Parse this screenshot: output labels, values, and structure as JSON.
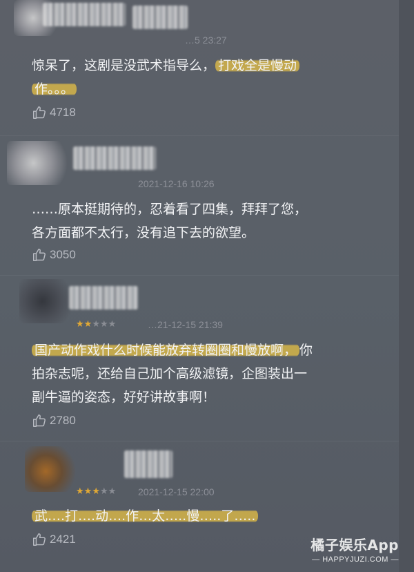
{
  "comments": [
    {
      "timestamp": "…5 23:27",
      "body_lines": [
        {
          "plain": "惊呆了，这剧是没武术指导么，",
          "highlight": "打戏全是慢动"
        },
        {
          "plain": "",
          "highlight": "作。。。"
        }
      ],
      "likes": "4718",
      "stars": {
        "filled": 0,
        "total": 0
      }
    },
    {
      "timestamp": "2021-12-16 10:26",
      "body_lines": [
        {
          "plain": "……原本挺期待的，忍着看了四集，拜拜了您，",
          "highlight": ""
        },
        {
          "plain": "各方面都不太行，没有追下去的欲望。",
          "highlight": ""
        }
      ],
      "likes": "3050",
      "stars": {
        "filled": 0,
        "total": 0
      }
    },
    {
      "timestamp": "…21-12-15 21:39",
      "body_lines": [
        {
          "plain": "",
          "highlight": "国产动作戏什么时候能放弃转圈圈和慢放啊，",
          "tail": "你"
        },
        {
          "plain": "拍杂志呢，还给自己加个高级滤镜，企图装出一",
          "highlight": ""
        },
        {
          "plain": "副牛逼的姿态，好好讲故事啊！",
          "highlight": ""
        }
      ],
      "likes": "2780",
      "stars": {
        "filled": 2,
        "total": 5
      }
    },
    {
      "timestamp": "2021-12-15 22:00",
      "body_lines": [
        {
          "plain": "",
          "highlight": "武….打….动….作…太…..慢…..了….."
        }
      ],
      "likes": "2421",
      "stars": {
        "filled": 3,
        "total": 5
      }
    }
  ],
  "watermark": {
    "brand": "橘子娱乐App",
    "url": "— HAPPYJUZI.COM —"
  },
  "icons": {
    "like": "thumbs-up-icon",
    "star": "star-icon"
  },
  "colors": {
    "background": "#5a5e66",
    "text": "#f1f2f4",
    "muted": "#b9bcc3",
    "highlight": "#e0bc46",
    "star_on": "#e1a935"
  }
}
